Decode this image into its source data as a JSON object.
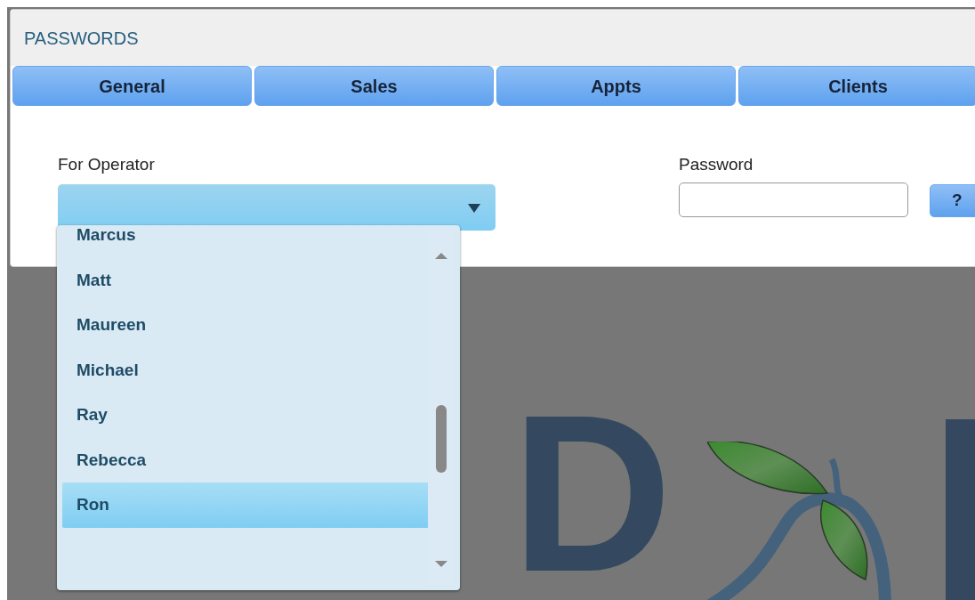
{
  "window": {
    "title": "PASSWORDS"
  },
  "tabs": [
    {
      "label": "General",
      "selected": false
    },
    {
      "label": "Sales",
      "selected": false
    },
    {
      "label": "Appts",
      "selected": false
    },
    {
      "label": "Clients",
      "selected": false
    }
  ],
  "operator": {
    "label": "For Operator",
    "expanded": true,
    "options": [
      {
        "label": "Marcus",
        "selected": false
      },
      {
        "label": "Matt",
        "selected": false
      },
      {
        "label": "Maureen",
        "selected": false
      },
      {
        "label": "Michael",
        "selected": false
      },
      {
        "label": "Ray",
        "selected": false
      },
      {
        "label": "Rebecca",
        "selected": false
      },
      {
        "label": "Ron",
        "selected": true
      }
    ]
  },
  "password": {
    "label": "Password"
  },
  "help_button": {
    "label": "?"
  },
  "backdrop_logo": {
    "text": "D"
  }
}
